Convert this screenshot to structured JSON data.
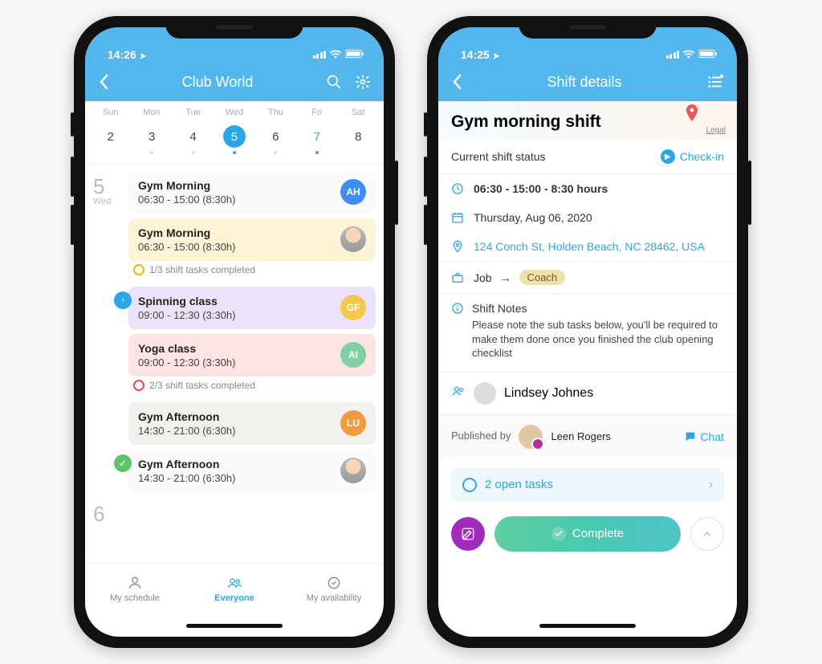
{
  "phone1": {
    "status_time": "14:26",
    "header": {
      "title": "Club World"
    },
    "week": {
      "days": [
        {
          "dow": "Sun",
          "num": "2",
          "dots": 0,
          "selected": false
        },
        {
          "dow": "Mon",
          "num": "3",
          "dots": 1,
          "selected": false
        },
        {
          "dow": "Tue",
          "num": "4",
          "dots": 1,
          "selected": false
        },
        {
          "dow": "Wed",
          "num": "5",
          "dots": 1,
          "selected": true
        },
        {
          "dow": "Thu",
          "num": "6",
          "dots": 1,
          "selected": false
        },
        {
          "dow": "Fri",
          "num": "7",
          "dots": 1,
          "selected": false,
          "accent": true
        },
        {
          "dow": "Sat",
          "num": "8",
          "dots": 0,
          "selected": false
        }
      ]
    },
    "day_label": {
      "num": "5",
      "dow": "Wed"
    },
    "shifts": [
      {
        "title": "Gym Morning",
        "time": "06:30 - 15:00 (8:30h)",
        "avatar": {
          "type": "initials",
          "text": "AH",
          "cls": "av-blue"
        },
        "bg": "bg-white2"
      },
      {
        "title": "Gym Morning",
        "time": "06:30 - 15:00 (8:30h)",
        "avatar": {
          "type": "photo"
        },
        "bg": "bg-cream",
        "sub": "1/3 shift tasks completed",
        "subring": "ring"
      },
      {
        "title": "Spinning class",
        "time": "09:00 - 12:30 (3:30h)",
        "avatar": {
          "type": "initials",
          "text": "GF",
          "cls": "av-yellow"
        },
        "bg": "bg-lav",
        "lead": "clock"
      },
      {
        "title": "Yoga class",
        "time": "09:00 - 12:30 (3:30h)",
        "avatar": {
          "type": "initials",
          "text": "AI",
          "cls": "av-green"
        },
        "bg": "bg-pink",
        "sub": "2/3 shift tasks completed",
        "subring": "ring red"
      },
      {
        "title": "Gym Afternoon",
        "time": "14:30 - 21:00 (6:30h)",
        "avatar": {
          "type": "initials",
          "text": "LU",
          "cls": "av-orange"
        },
        "bg": "bg-grey"
      },
      {
        "title": "Gym Afternoon",
        "time": "14:30 - 21:00 (6:30h)",
        "avatar": {
          "type": "photo"
        },
        "bg": "bg-white2",
        "lead": "check"
      }
    ],
    "next_day_num": "6",
    "tabs": {
      "my_schedule": "My schedule",
      "everyone": "Everyone",
      "availability": "My availability"
    }
  },
  "phone2": {
    "status_time": "14:25",
    "header": {
      "title": "Shift details"
    },
    "detail_title": "Gym morning shift",
    "legal": "Legal",
    "status": {
      "label": "Current shift status",
      "action": "Check-in"
    },
    "time_line": "06:30 - 15:00 - 8:30 hours",
    "date_line": "Thursday, Aug 06, 2020",
    "address": "124 Conch St, Holden Beach, NC 28462, USA",
    "job": {
      "label": "Job",
      "arrow": "→",
      "value": "Coach"
    },
    "notes": {
      "label": "Shift Notes",
      "body": "Please note the sub tasks below, you'll be required to make them done once you finished the club opening checklist"
    },
    "assignee": "Lindsey Johnes",
    "published": {
      "by_label": "Published by",
      "name": "Leen Rogers",
      "chat": "Chat"
    },
    "tasks_bar": "2 open tasks",
    "complete_label": "Complete"
  }
}
